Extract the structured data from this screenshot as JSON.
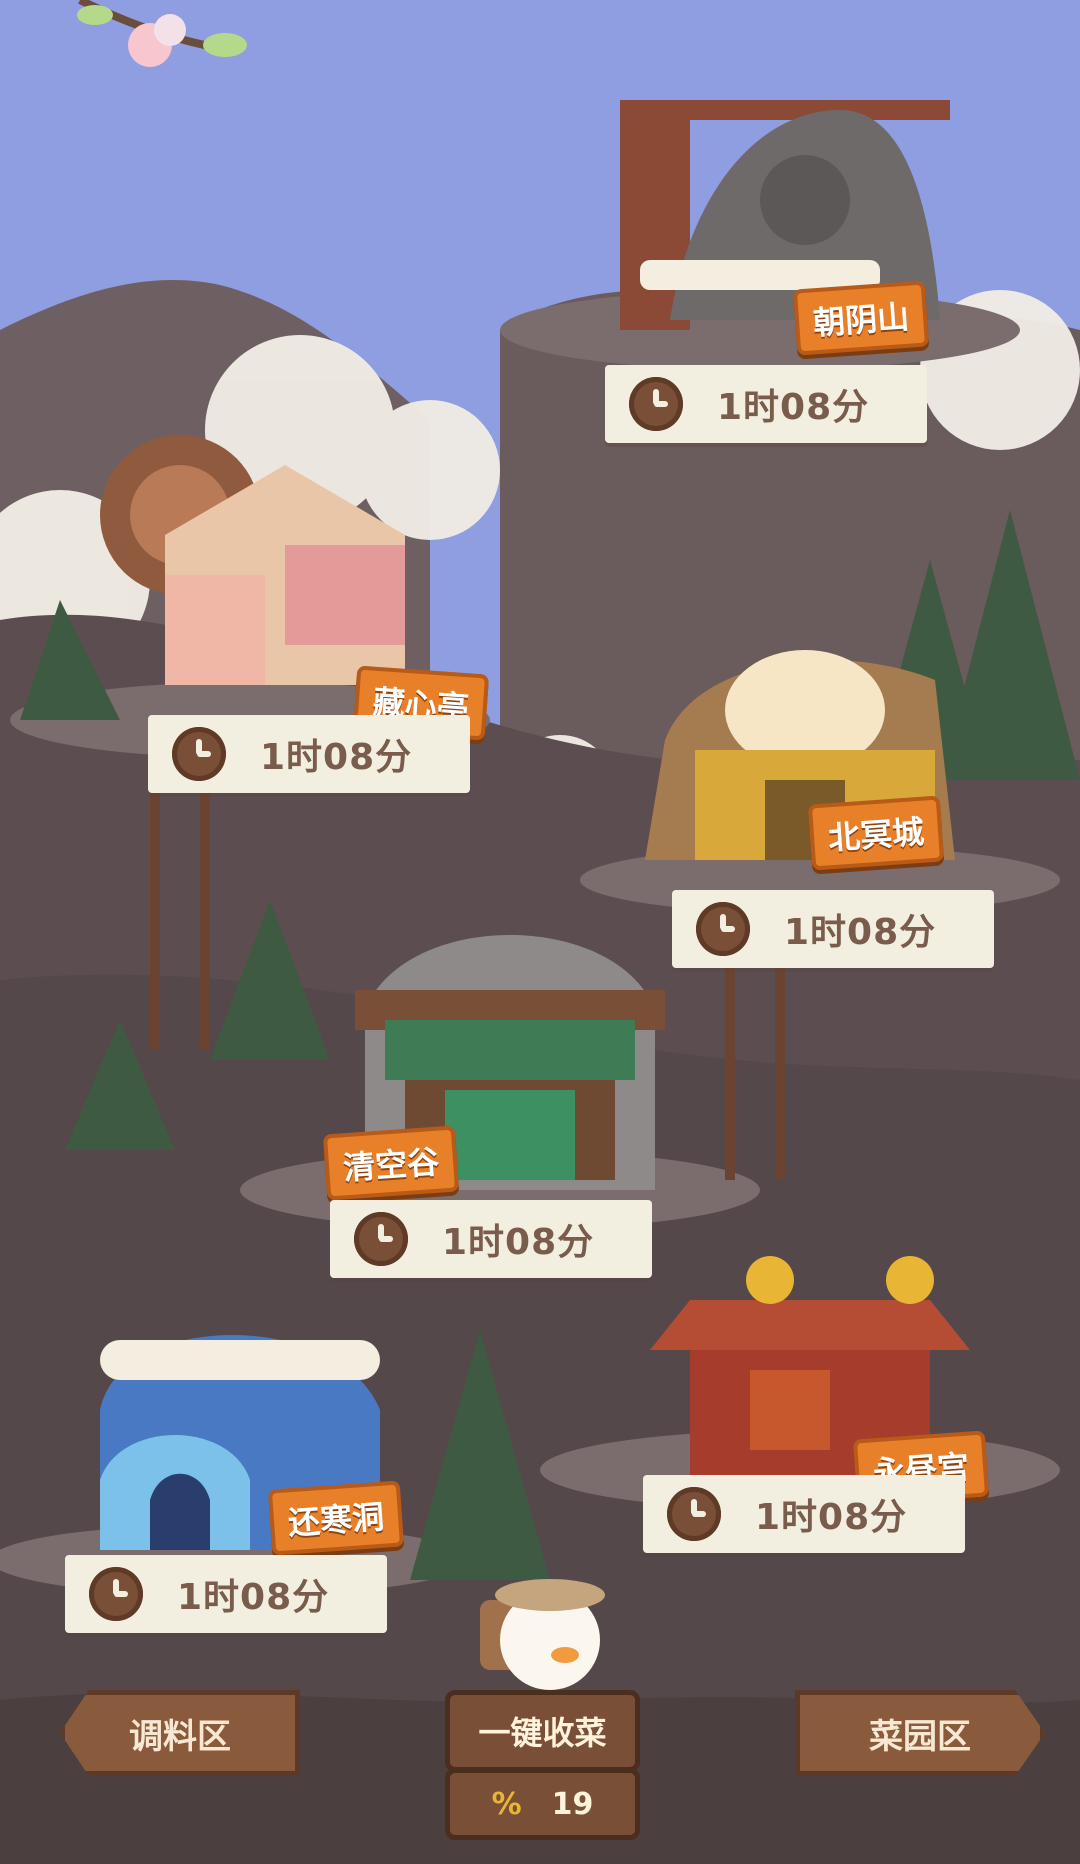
{
  "locations": [
    {
      "name": "朝阴山",
      "timer": "1时08分"
    },
    {
      "name": "藏心亭",
      "timer": "1时08分"
    },
    {
      "name": "北冥城",
      "timer": "1时08分"
    },
    {
      "name": "清空谷",
      "timer": "1时08分"
    },
    {
      "name": "永昼宫",
      "timer": "1时08分"
    },
    {
      "name": "还寒洞",
      "timer": "1时08分"
    }
  ],
  "nav": {
    "left_label": "调料区",
    "right_label": "菜园区",
    "harvest_label": "一键收菜",
    "counter_value": "19"
  },
  "colors": {
    "sky": "#8f9ee0",
    "mountain": "#6a5a5a",
    "label_bg": "#f3efe0",
    "tag_orange": "#e8802a",
    "wood": "#8a5a3c"
  }
}
